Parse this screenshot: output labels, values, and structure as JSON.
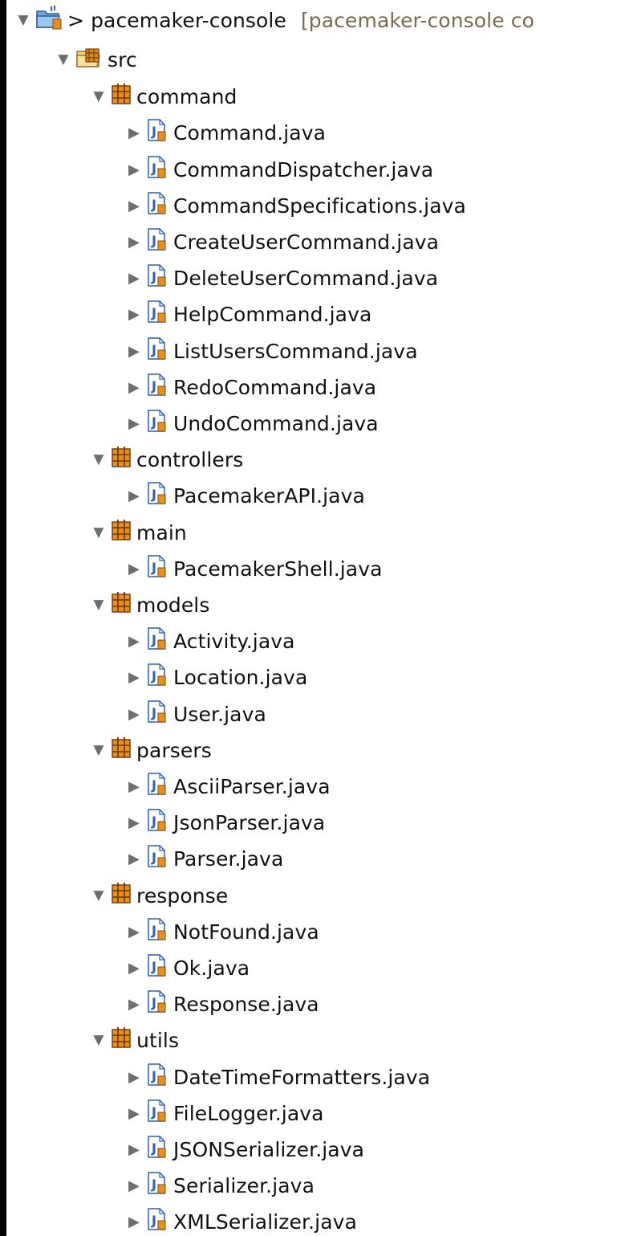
{
  "project": {
    "arrow": ">",
    "name": "pacemaker-console",
    "decoration": "[pacemaker-console co"
  },
  "src": {
    "label": "src"
  },
  "packages": [
    {
      "name": "command",
      "files": [
        "Command.java",
        "CommandDispatcher.java",
        "CommandSpecifications.java",
        "CreateUserCommand.java",
        "DeleteUserCommand.java",
        "HelpCommand.java",
        "ListUsersCommand.java",
        "RedoCommand.java",
        "UndoCommand.java"
      ]
    },
    {
      "name": "controllers",
      "files": [
        "PacemakerAPI.java"
      ]
    },
    {
      "name": "main",
      "files": [
        "PacemakerShell.java"
      ]
    },
    {
      "name": "models",
      "files": [
        "Activity.java",
        "Location.java",
        "User.java"
      ]
    },
    {
      "name": "parsers",
      "files": [
        "AsciiParser.java",
        "JsonParser.java",
        "Parser.java"
      ]
    },
    {
      "name": "response",
      "files": [
        "NotFound.java",
        "Ok.java",
        "Response.java"
      ]
    },
    {
      "name": "utils",
      "files": [
        "DateTimeFormatters.java",
        "FileLogger.java",
        "JSONSerializer.java",
        "Serializer.java",
        "XMLSerializer.java"
      ]
    }
  ],
  "icons": {
    "project": "java-project-folder-icon",
    "source_folder": "source-folder-icon",
    "package": "package-icon",
    "file": "java-file-icon"
  },
  "colors": {
    "package_brown": "#8a4a12",
    "package_orange": "#e8901a",
    "java_blue": "#2d5fb3",
    "twisty_gray": "#6e6e6e"
  }
}
